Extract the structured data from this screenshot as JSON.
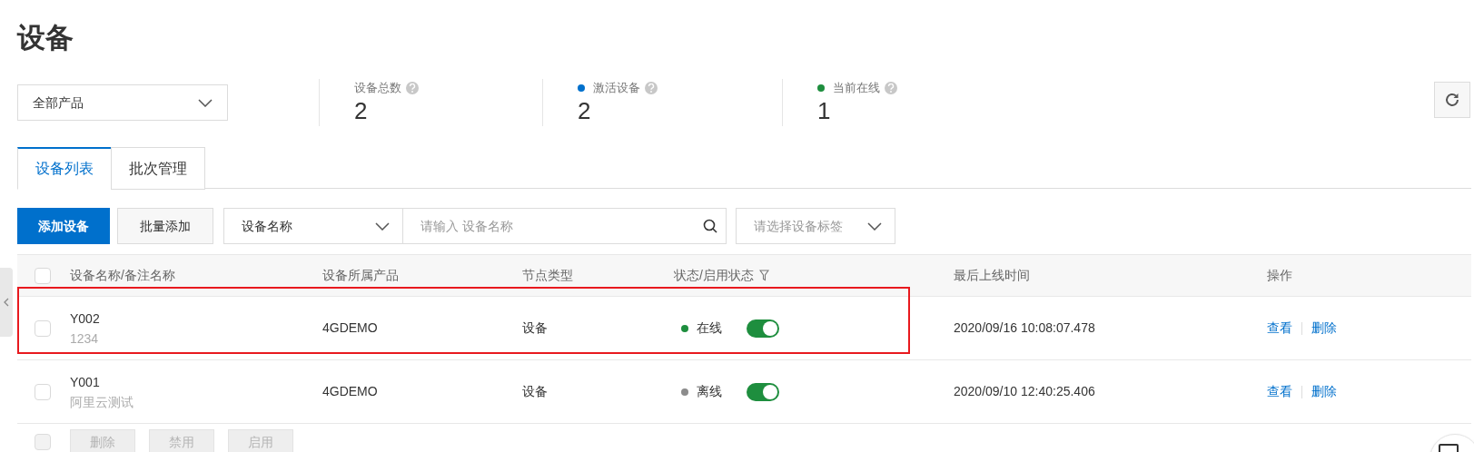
{
  "title": "设备",
  "product_filter": {
    "value": "全部产品"
  },
  "stats": [
    {
      "label": "设备总数",
      "value": "2"
    },
    {
      "label": "激活设备",
      "value": "2",
      "color": "#0070cc"
    },
    {
      "label": "当前在线",
      "value": "1",
      "color": "#1e8e3e"
    }
  ],
  "tabs": [
    {
      "label": "设备列表",
      "selected": true
    },
    {
      "label": "批次管理",
      "selected": false
    }
  ],
  "toolbar": {
    "add_button": "添加设备",
    "batch_button": "批量添加",
    "search_by": {
      "value": "设备名称"
    },
    "search_input": {
      "placeholder": "请输入 设备名称"
    },
    "tag_select": {
      "placeholder": "请选择设备标签"
    }
  },
  "table": {
    "header_checked": false,
    "columns": [
      "设备名称/备注名称",
      "设备所属产品",
      "节点类型",
      "状态/启用状态",
      "最后上线时间",
      "操作"
    ],
    "rows": [
      {
        "checked": false,
        "highlighted": true,
        "name": "Y002",
        "note": "1234",
        "product": "4GDEMO",
        "node_type": "设备",
        "status": "在线",
        "color": "#1e8e3e",
        "enabled": true,
        "last_online": "2020/09/16 10:08:07.478",
        "actions": [
          "查看",
          "删除"
        ]
      },
      {
        "checked": false,
        "highlighted": false,
        "name": "Y001",
        "note": "阿里云测试",
        "product": "4GDEMO",
        "node_type": "设备",
        "status": "离线",
        "color": "#8c8c8c",
        "enabled": true,
        "last_online": "2020/09/10 12:40:25.406",
        "actions": [
          "查看",
          "删除"
        ]
      }
    ]
  },
  "bulk": {
    "checked": false,
    "actions": [
      {
        "label": "删除",
        "disabled": true
      },
      {
        "label": "禁用",
        "disabled": true
      },
      {
        "label": "启用",
        "disabled": true
      }
    ]
  }
}
